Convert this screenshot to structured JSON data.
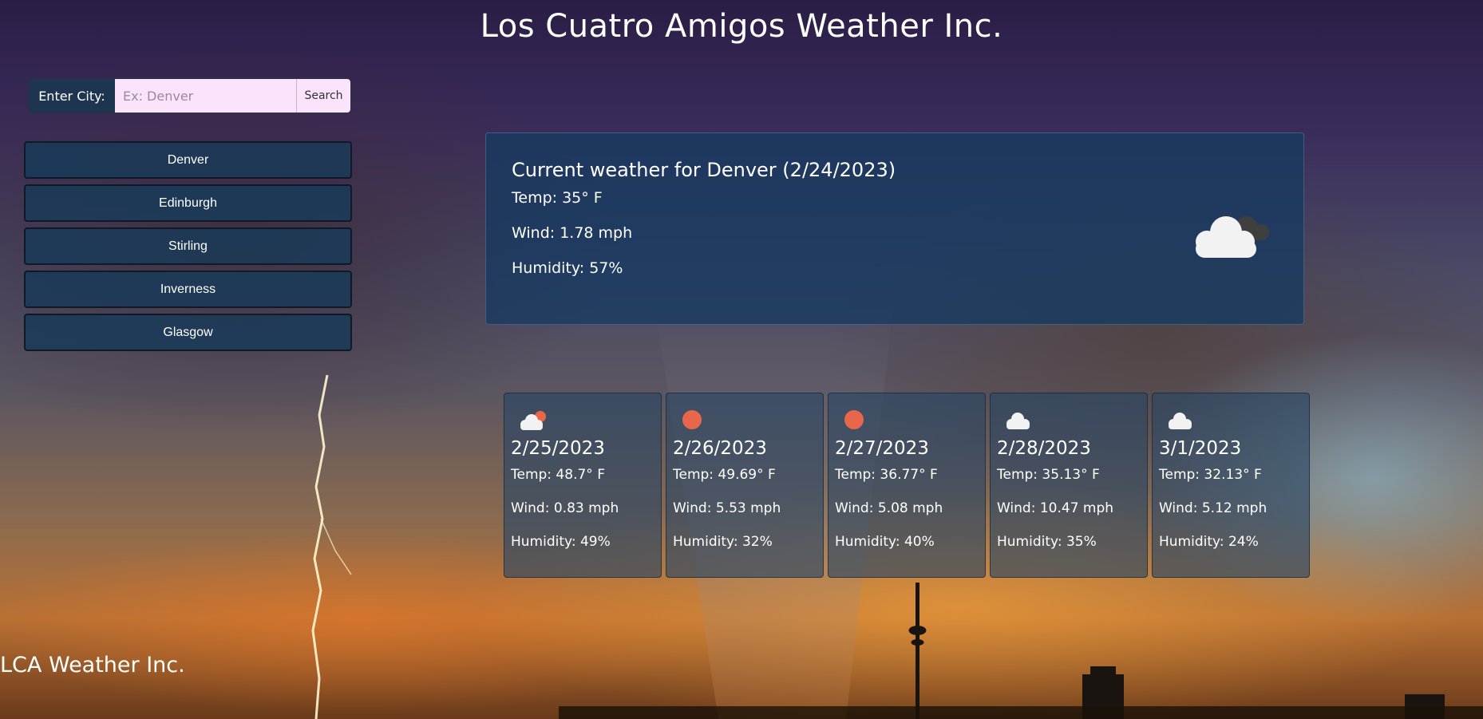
{
  "header": {
    "title": "Los Cuatro Amigos Weather Inc."
  },
  "search": {
    "label": "Enter City:",
    "placeholder": "Ex: Denver",
    "value": "",
    "button_label": "Search"
  },
  "history": {
    "cities": [
      {
        "label": "Denver"
      },
      {
        "label": "Edinburgh"
      },
      {
        "label": "Stirling"
      },
      {
        "label": "Inverness"
      },
      {
        "label": "Glasgow"
      }
    ]
  },
  "current": {
    "heading": "Current weather for Denver (2/24/2023)",
    "temp": "Temp: 35° F",
    "wind": "Wind: 1.78 mph",
    "humidity": "Humidity: 57%",
    "icon": "broken-clouds-icon"
  },
  "forecast": [
    {
      "date": "2/25/2023",
      "temp": "Temp: 48.7° F",
      "wind": "Wind: 0.83 mph",
      "humidity": "Humidity: 49%",
      "icon": "partly-cloudy-icon"
    },
    {
      "date": "2/26/2023",
      "temp": "Temp: 49.69° F",
      "wind": "Wind: 5.53 mph",
      "humidity": "Humidity: 32%",
      "icon": "clear-sun-icon"
    },
    {
      "date": "2/27/2023",
      "temp": "Temp: 36.77° F",
      "wind": "Wind: 5.08 mph",
      "humidity": "Humidity: 40%",
      "icon": "clear-sun-icon"
    },
    {
      "date": "2/28/2023",
      "temp": "Temp: 35.13° F",
      "wind": "Wind: 10.47 mph",
      "humidity": "Humidity: 35%",
      "icon": "cloud-icon"
    },
    {
      "date": "3/1/2023",
      "temp": "Temp: 32.13° F",
      "wind": "Wind: 5.12 mph",
      "humidity": "Humidity: 24%",
      "icon": "cloud-icon"
    }
  ],
  "footer": {
    "text": "LCA Weather Inc."
  },
  "colors": {
    "sun": "#e8674a",
    "panel": "#163a60",
    "input_bg": "#fbe3fb"
  }
}
